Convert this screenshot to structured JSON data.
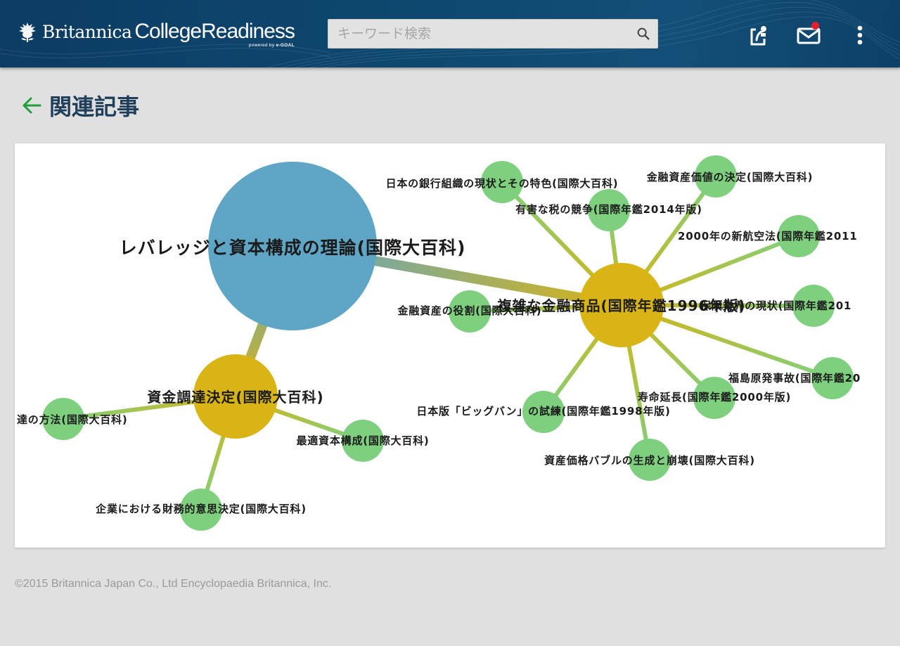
{
  "header": {
    "brand_name": "Britannica",
    "product_name": "CollegeReadiness",
    "powered_by_prefix": "powered by",
    "powered_by_name": "e-GOAL",
    "search_placeholder": "キーワード検索",
    "icons": [
      "britannica-thistle-logo-icon",
      "search-icon",
      "share-icon",
      "mail-icon",
      "more-vert-icon"
    ],
    "mail_badge_color": "#e5202e"
  },
  "page": {
    "title": "関連記事",
    "back_icon": "arrow-left-icon",
    "accent_color": "#1f9e3a"
  },
  "graph": {
    "colors": {
      "main": "#5fa6c6",
      "hub": "#d8b415",
      "leaf": "#7ed07e"
    },
    "nodes": [
      {
        "id": "n0",
        "kind": "main",
        "label": "レバレッジと資本構成の理論(国際大百科)"
      },
      {
        "id": "n1",
        "kind": "hub",
        "label": "複雑な金融商品(国際年鑑1996年版)"
      },
      {
        "id": "n2",
        "kind": "hub",
        "label": "資金調達決定(国際大百科)"
      },
      {
        "id": "n3",
        "kind": "leaf",
        "label": "日本の銀行組織の現状とその特色(国際大百科)"
      },
      {
        "id": "n4",
        "kind": "leaf",
        "label": "有害な税の競争(国際年鑑2014年版)"
      },
      {
        "id": "n5",
        "kind": "leaf",
        "label": "金融資産価値の決定(国際大百科)"
      },
      {
        "id": "n6",
        "kind": "leaf",
        "label": "2000年の新航空法(国際年鑑2011"
      },
      {
        "id": "n7",
        "kind": "leaf",
        "label": "金融資産の役割(国際大百科)"
      },
      {
        "id": "n8",
        "kind": "leaf",
        "label": "保険業界の現状(国際年鑑201"
      },
      {
        "id": "n9",
        "kind": "leaf",
        "label": "福島原発事故(国際年鑑20"
      },
      {
        "id": "n10",
        "kind": "leaf",
        "label": "寿命延長(国際年鑑2000年版)"
      },
      {
        "id": "n11",
        "kind": "leaf",
        "label": "日本版「ビッグバン」の試練(国際年鑑1998年版)"
      },
      {
        "id": "n12",
        "kind": "leaf",
        "label": "資産価格バブルの生成と崩壊(国際大百科)"
      },
      {
        "id": "n13",
        "kind": "leaf",
        "label": "最適資本構成(国際大百科)"
      },
      {
        "id": "n14",
        "kind": "leaf",
        "label": "達の方法(国際大百科)"
      },
      {
        "id": "n15",
        "kind": "leaf",
        "label": "企業における財務的意思決定(国際大百科)"
      }
    ],
    "edges": [
      [
        "n0",
        "n1"
      ],
      [
        "n0",
        "n2"
      ],
      [
        "n1",
        "n3"
      ],
      [
        "n1",
        "n4"
      ],
      [
        "n1",
        "n5"
      ],
      [
        "n1",
        "n6"
      ],
      [
        "n1",
        "n7"
      ],
      [
        "n1",
        "n8"
      ],
      [
        "n1",
        "n9"
      ],
      [
        "n1",
        "n10"
      ],
      [
        "n1",
        "n11"
      ],
      [
        "n1",
        "n12"
      ],
      [
        "n2",
        "n13"
      ],
      [
        "n2",
        "n14"
      ],
      [
        "n2",
        "n15"
      ]
    ]
  },
  "footer": {
    "copyright": "©2015 Britannica Japan Co., Ltd Encyclopaedia Britannica, Inc."
  }
}
